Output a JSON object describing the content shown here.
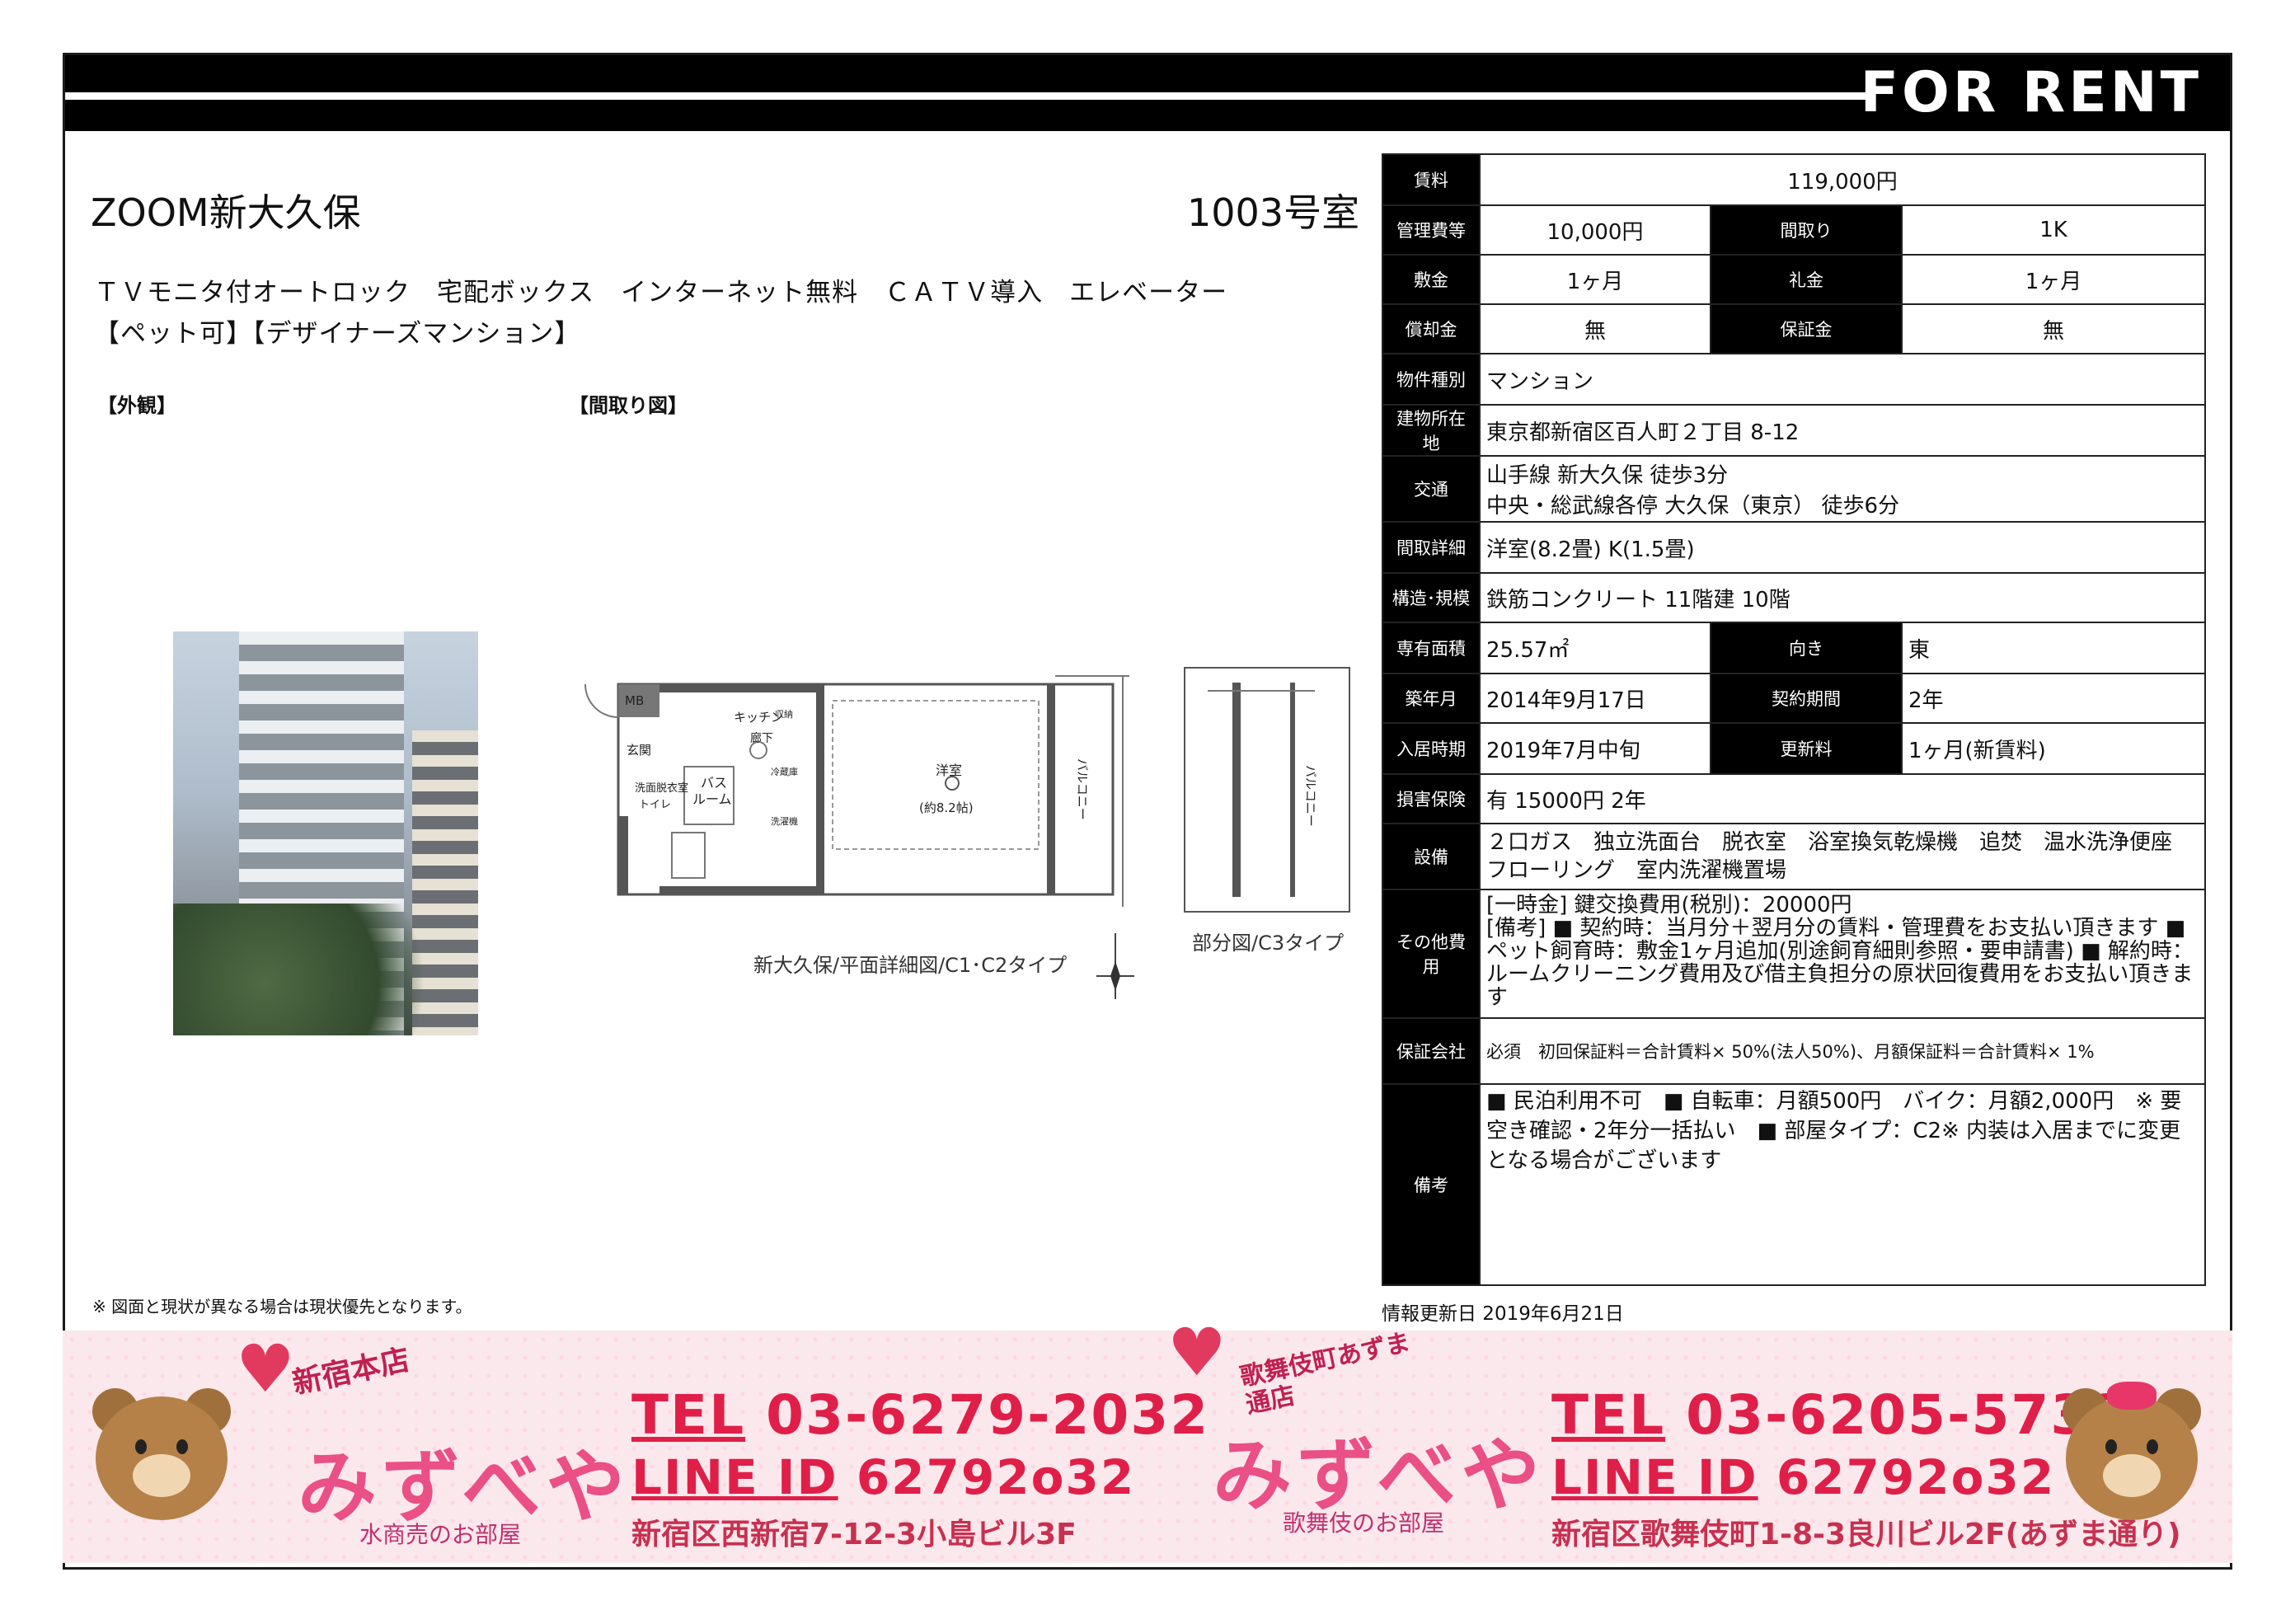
{
  "header": {
    "for_rent": "FOR RENT"
  },
  "property": {
    "name": "ZOOM新大久保",
    "room": "1003号室",
    "features_line1": "ＴＶモニタ付オートロック　宅配ボックス　インターネット無料　ＣＡＴＶ導入　エレベーター",
    "features_line2": "【ペット可】【デザイナーズマンション】",
    "exterior_caption": "【外観】",
    "floorplan_caption": "【間取り図】",
    "floorplan_label": "新大久保/平面詳細図/C1･C2タイプ",
    "partial_label": "部分図/C3タイプ",
    "plan_texts": {
      "mb": "MB",
      "kitchen": "キッチン",
      "hall": "廊下",
      "entrance": "玄関",
      "washroom": "洗面脱衣室",
      "toilet": "トイレ",
      "bath": "バス",
      "bath2": "ルーム",
      "room": "洋室",
      "room_size": "(約8.2帖)",
      "balcony": "バルコニー",
      "storage": "収納",
      "fridge": "冷蔵庫",
      "washer": "洗濯機"
    },
    "note": "※ 図面と現状が異なる場合は現状優先となります。"
  },
  "spec": {
    "rent_label": "賃料",
    "rent": "119,000円",
    "mgmt_label": "管理費等",
    "mgmt": "10,000円",
    "layout_label": "間取り",
    "layout": "1K",
    "deposit_label": "敷金",
    "deposit": "1ヶ月",
    "key_money_label": "礼金",
    "key_money": "1ヶ月",
    "amort_label": "償却金",
    "amort": "無",
    "guarantee_label": "保証金",
    "guarantee": "無",
    "type_label": "物件種別",
    "type": "マンション",
    "address_label": "建物所在地",
    "address": "東京都新宿区百人町２丁目 8-12",
    "transport_label": "交通",
    "transport1": "山手線 新大久保 徒歩3分",
    "transport2": "中央・総武線各停 大久保（東京） 徒歩6分",
    "layout_detail_label": "間取詳細",
    "layout_detail": "洋室(8.2畳) K(1.5畳)",
    "structure_label": "構造･規模",
    "structure": "鉄筋コンクリート 11階建 10階",
    "area_label": "専有面積",
    "area": "25.57㎡",
    "direction_label": "向き",
    "direction": "東",
    "built_label": "築年月",
    "built": "2014年9月17日",
    "contract_label": "契約期間",
    "contract": "2年",
    "move_in_label": "入居時期",
    "move_in": "2019年7月中旬",
    "renewal_label": "更新料",
    "renewal": "1ヶ月(新賃料)",
    "insurance_label": "損害保険",
    "insurance": "有  15000円 2年",
    "facilities_label": "設備",
    "facilities": "２口ガス　独立洗面台　脱衣室　浴室換気乾燥機　追焚　温水洗浄便座　フローリング　室内洗濯機置場",
    "other_costs_label": "その他費用",
    "other_costs1": "[一時金]   鍵交換費用(税別)：20000円",
    "other_costs2": "[備考]  ■ 契約時：当月分＋翌月分の賃料・管理費をお支払い頂きます  ■ ペット飼育時：敷金1ヶ月追加(別途飼育細則参照・要申請書)  ■ 解約時：ルームクリーニング費用及び借主負担分の原状回復費用をお支払い頂きます",
    "guarantor_label": "保証会社",
    "guarantor": "必須　初回保証料＝合計賃料× 50%(法人50%)、月額保証料＝合計賃料× 1%",
    "remarks_label": "備考",
    "remarks": "■ 民泊利用不可　■ 自転車：月額500円　バイク：月額2,000円　※ 要空き確認・2年分一括払い　■ 部屋タイプ：C2※ 内装は入居までに変更となる場合がございます",
    "updated": "情報更新日 2019年6月21日"
  },
  "banner": {
    "shop1_badge": "新宿本店",
    "shop1_logo": "みずべや",
    "shop1_sub": "水商売のお部屋",
    "shop1_tel_label": "TEL",
    "shop1_tel": "03-6279-2032",
    "shop1_line_label": "LINE ID",
    "shop1_line": "62792o32",
    "shop1_addr": "新宿区西新宿7-12-3小島ビル3F",
    "shop2_badge": "歌舞伎町あずま通店",
    "shop2_logo": "みずべや",
    "shop2_sub": "歌舞伎のお部屋",
    "shop2_tel_label": "TEL",
    "shop2_tel": "03-6205-5732",
    "shop2_line_label": "LINE ID",
    "shop2_line": "62792o32",
    "shop2_addr": "新宿区歌舞伎町1-8-3良川ビル2F(あずま通り)"
  },
  "colors": {
    "header_bg": "#000000",
    "label_bg": "#000000",
    "banner_bg": "#fbe8ec",
    "banner_red": "#e01f49",
    "banner_pink": "#ea4f86"
  }
}
